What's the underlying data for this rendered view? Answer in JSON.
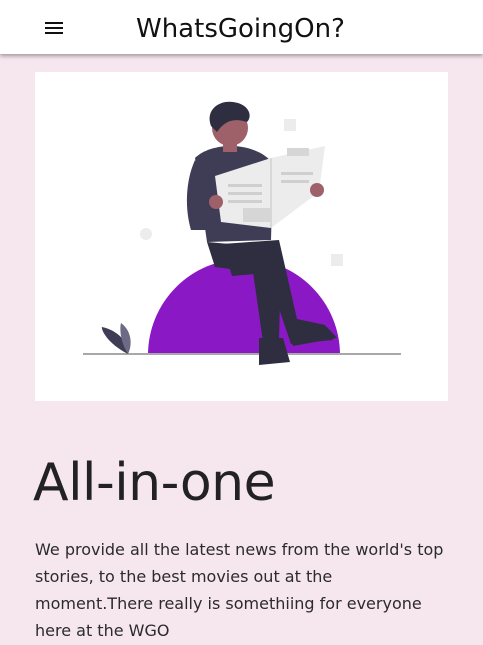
{
  "header": {
    "app_title": "WhatsGoingOn?",
    "menu_icon": "hamburger-menu-icon"
  },
  "hero": {
    "illustration": "person-reading-newspaper-illustration",
    "accent_color": "#8a18c4"
  },
  "main": {
    "headline": "All-in-one",
    "description": "We provide all the latest news from the world's top stories, to the best movies out at the moment.There really is somethiing for everyone here at the WGO"
  },
  "colors": {
    "page_background": "#f6e6ee",
    "header_background": "#ffffff"
  }
}
